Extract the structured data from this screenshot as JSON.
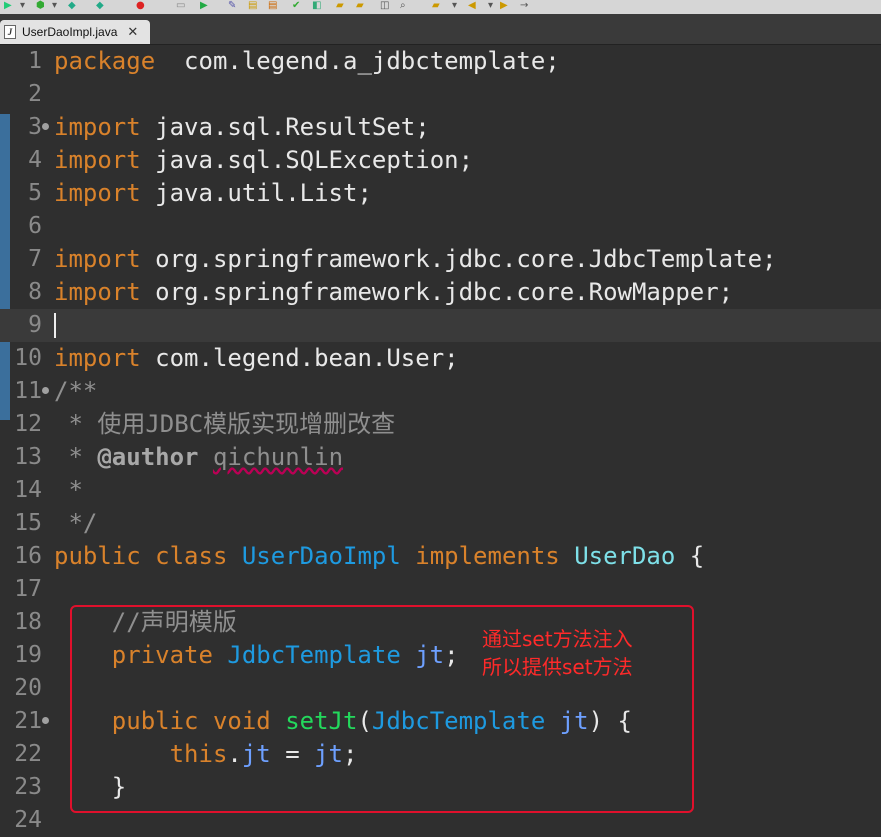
{
  "tab": {
    "label": "UserDaoImpl.java",
    "file_icon": "J"
  },
  "code_lines": [
    {
      "num": "1",
      "parts": [
        [
          "kw",
          "package"
        ],
        [
          "",
          "  com.legend.a_jdbctemplate;"
        ]
      ]
    },
    {
      "num": "2",
      "parts": []
    },
    {
      "num": "3",
      "parts": [
        [
          "kw",
          "import"
        ],
        [
          "",
          " java.sql.ResultSet;"
        ]
      ]
    },
    {
      "num": "4",
      "parts": [
        [
          "kw",
          "import"
        ],
        [
          "",
          " java.sql.SQLException;"
        ]
      ]
    },
    {
      "num": "5",
      "parts": [
        [
          "kw",
          "import"
        ],
        [
          "",
          " java.util.List;"
        ]
      ]
    },
    {
      "num": "6",
      "parts": []
    },
    {
      "num": "7",
      "parts": [
        [
          "kw",
          "import"
        ],
        [
          "",
          " org.springframework.jdbc.core.JdbcTemplate;"
        ]
      ]
    },
    {
      "num": "8",
      "parts": [
        [
          "kw",
          "import"
        ],
        [
          "",
          " org.springframework.jdbc.core.RowMapper;"
        ]
      ]
    },
    {
      "num": "9",
      "parts": []
    },
    {
      "num": "10",
      "parts": [
        [
          "kw",
          "import"
        ],
        [
          "",
          " com.legend.bean.User;"
        ]
      ]
    },
    {
      "num": "11",
      "parts": [
        [
          "cm",
          "/**"
        ]
      ]
    },
    {
      "num": "12",
      "parts": [
        [
          "cm",
          " * 使用JDBC模版实现增删改查"
        ]
      ]
    },
    {
      "num": "13",
      "parts": [
        [
          "cm",
          " * "
        ],
        [
          "cm-tag",
          "@author"
        ],
        [
          "cm",
          " "
        ],
        [
          "cm-name",
          "qichunlin"
        ]
      ]
    },
    {
      "num": "14",
      "parts": [
        [
          "cm",
          " *"
        ]
      ]
    },
    {
      "num": "15",
      "parts": [
        [
          "cm",
          " */"
        ]
      ]
    },
    {
      "num": "16",
      "parts": [
        [
          "kw",
          "public class "
        ],
        [
          "tp",
          "UserDaoImpl"
        ],
        [
          "kw",
          " implements "
        ],
        [
          "ifc",
          "UserDao"
        ],
        [
          "",
          " {"
        ]
      ]
    },
    {
      "num": "17",
      "parts": []
    },
    {
      "num": "18",
      "parts": [
        [
          "cm",
          "    //声明模版"
        ]
      ]
    },
    {
      "num": "19",
      "parts": [
        [
          "kw",
          "    private "
        ],
        [
          "tp",
          "JdbcTemplate"
        ],
        [
          "",
          " "
        ],
        [
          "fld",
          "jt"
        ],
        [
          "",
          ";"
        ]
      ]
    },
    {
      "num": "20",
      "parts": []
    },
    {
      "num": "21",
      "parts": [
        [
          "kw",
          "    public void "
        ],
        [
          "mth",
          "setJt"
        ],
        [
          "",
          "("
        ],
        [
          "tp",
          "JdbcTemplate"
        ],
        [
          "",
          " "
        ],
        [
          "fld",
          "jt"
        ],
        [
          "",
          ") {"
        ]
      ]
    },
    {
      "num": "22",
      "parts": [
        [
          "kw",
          "        this"
        ],
        [
          "",
          "."
        ],
        [
          "fld",
          "jt"
        ],
        [
          "",
          " = "
        ],
        [
          "fld",
          "jt"
        ],
        [
          "",
          ";"
        ]
      ]
    },
    {
      "num": "23",
      "parts": [
        [
          "",
          "    }"
        ]
      ]
    },
    {
      "num": "24",
      "parts": []
    }
  ],
  "fold_marker_lines": [
    "3",
    "11",
    "21"
  ],
  "current_line": "9",
  "annotation": {
    "line1": "通过set方法注入",
    "line2": "所以提供set方法"
  },
  "colors": {
    "keyword": "#d9822b",
    "type": "#1e9ae0",
    "comment": "#8f8f8f",
    "method": "#23d95c",
    "field": "#6ea0ff",
    "annotation": "#ff2a2a"
  }
}
